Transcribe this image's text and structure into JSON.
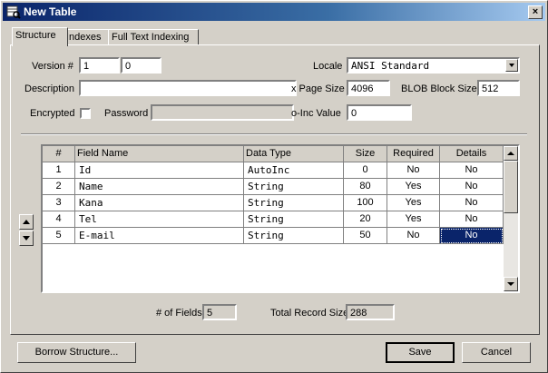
{
  "window": {
    "title": "New Table",
    "close_label": "×"
  },
  "tabs": [
    {
      "label": "Structure",
      "active": true
    },
    {
      "label": "Indexes",
      "active": false
    },
    {
      "label": "Full Text Indexing",
      "active": false
    }
  ],
  "form": {
    "version_label": "Version #",
    "version_major": "1",
    "version_minor": "0",
    "locale_label": "Locale",
    "locale_value": "ANSI Standard",
    "description_label": "Description",
    "description_value": "",
    "page_size_label": "x Page Size",
    "page_size_value": "4096",
    "blob_label": "BLOB Block Size",
    "blob_value": "512",
    "encrypted_label": "Encrypted",
    "password_label": "Password",
    "password_value": "",
    "autoinc_label": "o-Inc Value",
    "autoinc_value": "0"
  },
  "grid": {
    "columns": [
      "#",
      "Field Name",
      "Data Type",
      "Size",
      "Required",
      "Details"
    ],
    "rows": [
      [
        "1",
        "Id",
        "AutoInc",
        "0",
        "No",
        "No"
      ],
      [
        "2",
        "Name",
        "String",
        "80",
        "Yes",
        "No"
      ],
      [
        "3",
        "Kana",
        "String",
        "100",
        "Yes",
        "No"
      ],
      [
        "4",
        "Tel",
        "String",
        "20",
        "Yes",
        "No"
      ],
      [
        "5",
        "E-mail",
        "String",
        "50",
        "No",
        "No"
      ]
    ]
  },
  "summary": {
    "fields_label": "# of Fields",
    "fields_value": "5",
    "record_label": "Total Record Size",
    "record_value": "288"
  },
  "buttons": {
    "borrow": "Borrow Structure...",
    "save": "Save",
    "cancel": "Cancel"
  },
  "icons": [
    "table-icon",
    "close-icon",
    "dropdown-arrow-icon",
    "arrow-up-icon",
    "arrow-down-icon"
  ],
  "colors": {
    "titlebar": "#0a246a",
    "selection": "#0a246a",
    "face": "#d4d0c8"
  }
}
